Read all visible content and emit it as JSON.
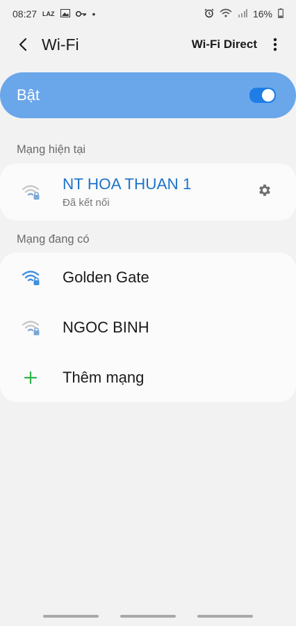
{
  "status_bar": {
    "time": "08:27",
    "notif_app": "LAZ",
    "dot": "•",
    "battery": "16%"
  },
  "header": {
    "title": "Wi-Fi",
    "action": "Wi-Fi Direct"
  },
  "toggle": {
    "label": "Bật",
    "state": "on"
  },
  "current": {
    "section_label": "Mạng hiện tại",
    "name": "NT HOA THUAN 1",
    "status": "Đã kết nối"
  },
  "available": {
    "section_label": "Mạng đang có",
    "networks": [
      {
        "name": "Golden Gate",
        "signal": "full"
      },
      {
        "name": "NGOC BINH",
        "signal": "weak"
      }
    ],
    "add_label": "Thêm mạng"
  },
  "colors": {
    "accent": "#1f73c9",
    "toggle_bg": "#6aa6ea",
    "add_icon": "#2db34a"
  }
}
